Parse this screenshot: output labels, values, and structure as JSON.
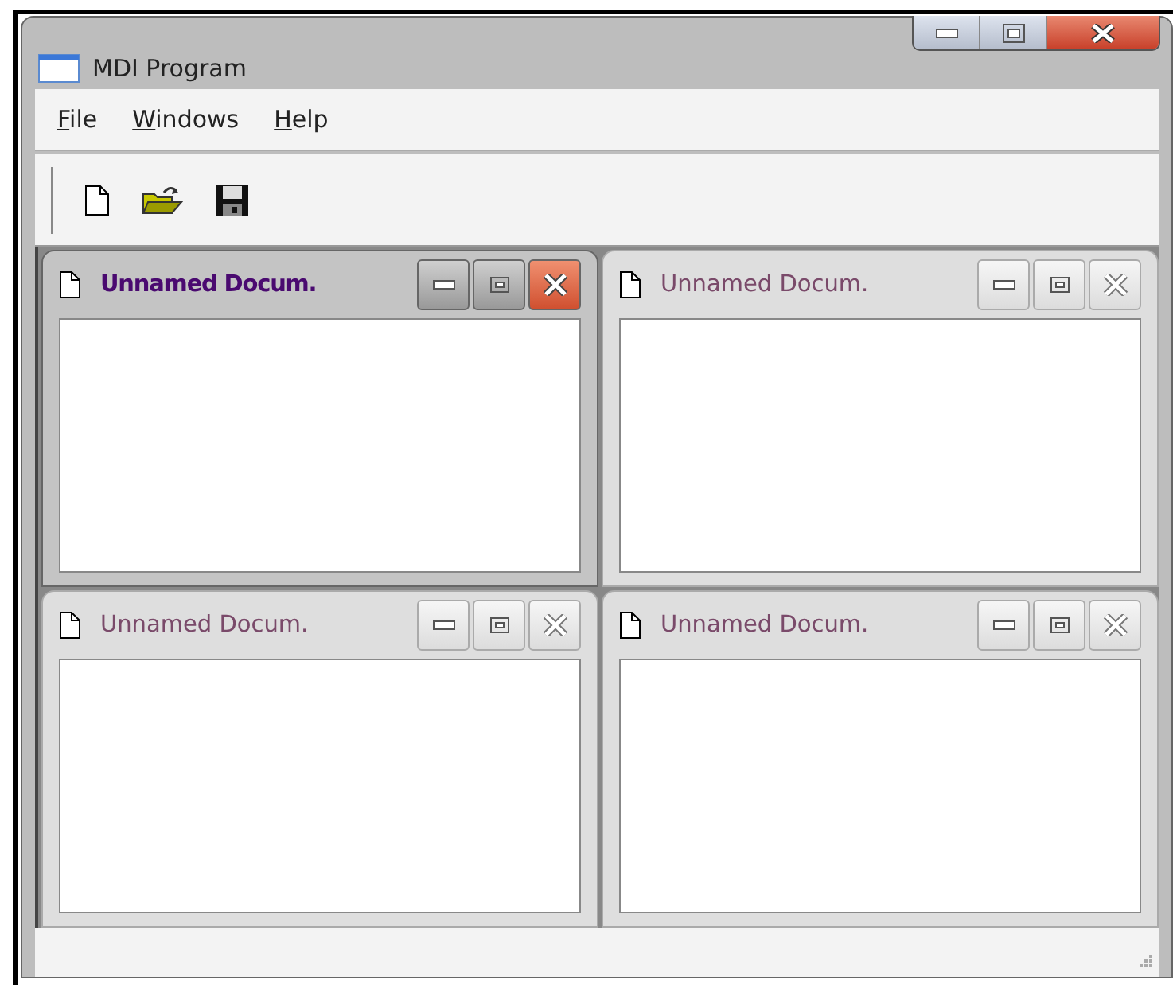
{
  "window": {
    "title": "MDI Program"
  },
  "menu": [
    {
      "accel": "F",
      "rest": "ile"
    },
    {
      "accel": "W",
      "rest": "indows"
    },
    {
      "accel": "H",
      "rest": "elp"
    }
  ],
  "documents": [
    {
      "title": "Unnamed Docum.",
      "active": true
    },
    {
      "title": "Unnamed Docum.",
      "active": false
    },
    {
      "title": "Unnamed Docum.",
      "active": false
    },
    {
      "title": "Unnamed Docum.",
      "active": false
    }
  ]
}
